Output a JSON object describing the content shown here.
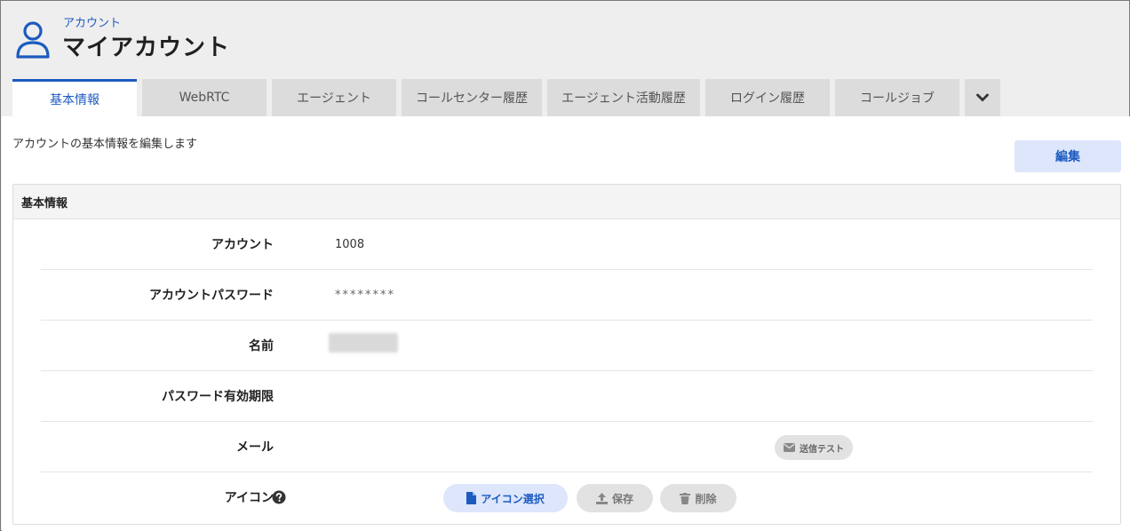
{
  "header": {
    "breadcrumb": "アカウント",
    "title": "マイアカウント"
  },
  "tabs": [
    {
      "label": "基本情報",
      "active": true
    },
    {
      "label": "WebRTC"
    },
    {
      "label": "エージェント"
    },
    {
      "label": "コールセンター履歴"
    },
    {
      "label": "エージェント活動履歴"
    },
    {
      "label": "ログイン履歴"
    },
    {
      "label": "コールジョブ"
    }
  ],
  "main": {
    "description": "アカウントの基本情報を編集します",
    "edit_label": "編集",
    "panel_title": "基本情報"
  },
  "fields": {
    "account": {
      "label": "アカウント",
      "value": "1008"
    },
    "password": {
      "label": "アカウントパスワード",
      "value": "********"
    },
    "name": {
      "label": "名前"
    },
    "password_expiry": {
      "label": "パスワード有効期限",
      "value": ""
    },
    "mail": {
      "label": "メール",
      "value": "",
      "send_test_label": "送信テスト"
    },
    "icon": {
      "label": "アイコン",
      "select_label": "アイコン選択",
      "save_label": "保存",
      "delete_label": "削除"
    }
  },
  "colors": {
    "accent": "#1d5bbf",
    "accent_bg": "#dde6fb",
    "button_grey": "#e2e2e2"
  },
  "icons": [
    "user-icon",
    "chevron-down-icon",
    "help-icon",
    "envelope-icon",
    "file-icon",
    "upload-icon",
    "trash-icon"
  ]
}
